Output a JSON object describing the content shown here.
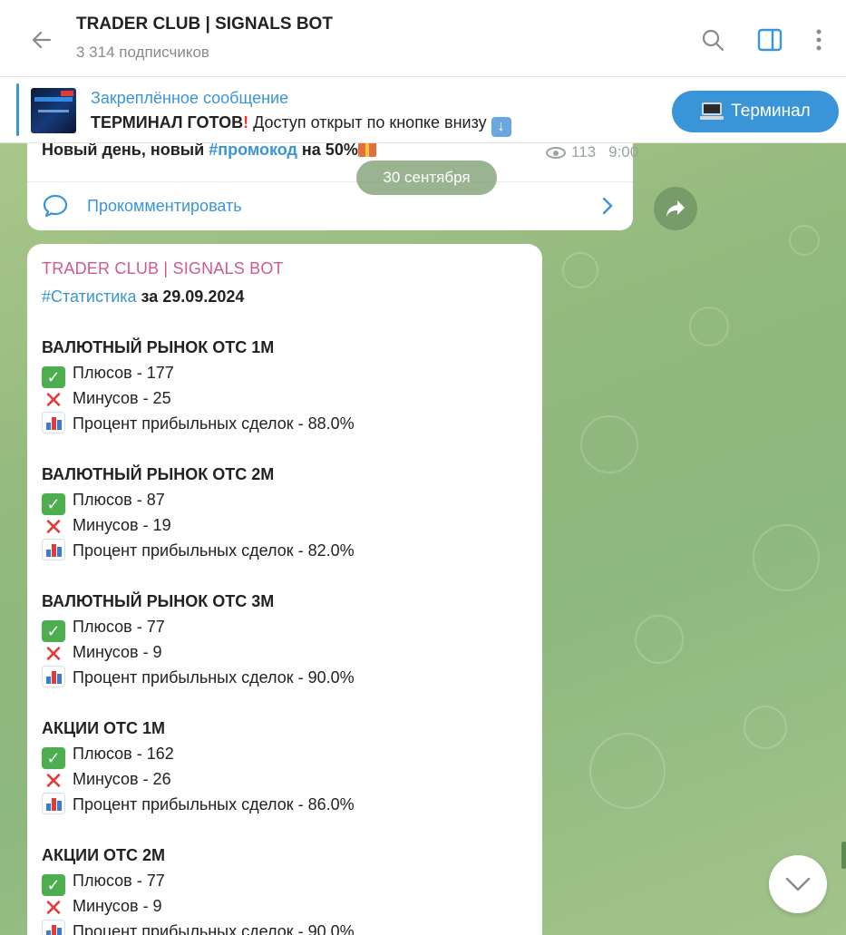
{
  "header": {
    "title": "TRADER CLUB | SIGNALS BOT",
    "subtitle": "3 314 подписчиков"
  },
  "pinned": {
    "label": "Закреплённое сообщение",
    "text_bold": "ТЕРМИНАЛ ГОТОВ",
    "text_rest": " Доступ открыт по кнопке внизу ",
    "button_label": "Терминал"
  },
  "prev_message": {
    "text_start": "Новый день, новый ",
    "hashtag": "#промокод",
    "text_end": " на 50%",
    "views": "113",
    "time": "9:00",
    "comment_label": "Прокомментировать"
  },
  "date_pill": "30 сентября",
  "message": {
    "sender": "TRADER CLUB | SIGNALS BOT",
    "hashtag": "#Статистика",
    "date_text": " за 29.09.2024",
    "sections": [
      {
        "title": "ВАЛЮТНЫЙ РЫНОК ОТС 1M",
        "plus": "Плюсов - 177",
        "minus": "Минусов - 25",
        "percent": "Процент прибыльных сделок - 88.0%"
      },
      {
        "title": "ВАЛЮТНЫЙ РЫНОК ОТС 2M",
        "plus": "Плюсов - 87",
        "minus": "Минусов - 19",
        "percent": "Процент прибыльных сделок - 82.0%"
      },
      {
        "title": "ВАЛЮТНЫЙ РЫНОК ОТС 3M",
        "plus": "Плюсов - 77",
        "minus": "Минусов - 9",
        "percent": "Процент прибыльных сделок - 90.0%"
      },
      {
        "title": "АКЦИИ ОТС 1M",
        "plus": "Плюсов - 162",
        "minus": "Минусов - 26",
        "percent": "Процент прибыльных сделок - 86.0%"
      },
      {
        "title": "АКЦИИ ОТС 2M",
        "plus": "Плюсов - 77",
        "minus": "Минусов - 9",
        "percent": "Процент прибыльных сделок - 90.0%"
      }
    ]
  },
  "icons": {
    "back": "arrow-left-icon",
    "search": "search-icon",
    "sidebar": "sidebar-toggle-icon",
    "more": "more-vertical-icon",
    "check": "check-mark-icon",
    "cross": "cross-mark-icon",
    "chart": "bar-chart-icon"
  },
  "colors": {
    "accent": "#3a95d8",
    "sender": "#cf5b8c",
    "check": "#4cae4f",
    "cross": "#e53935"
  }
}
